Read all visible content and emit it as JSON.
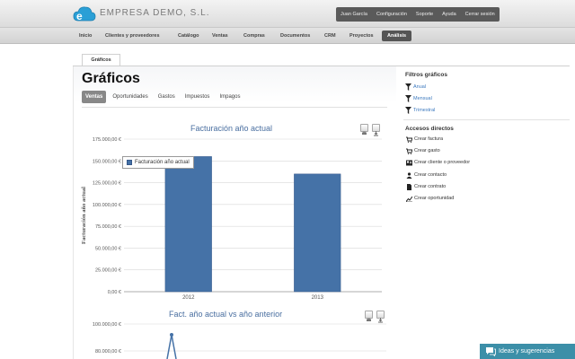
{
  "header": {
    "company": "EMPRESA DEMO, S.L.",
    "user_menu": [
      "Juan García",
      "Configuración",
      "Soporte",
      "Ayuda",
      "Cerrar sesión"
    ]
  },
  "nav": {
    "items": [
      "Inicio",
      "Clientes y proveedores",
      "Catálogo",
      "Ventas",
      "Compras",
      "Documentos",
      "CRM",
      "Proyectos",
      "Análisis"
    ],
    "active": "Análisis"
  },
  "page": {
    "tab": "Gráficos",
    "title": "Gráficos",
    "subtabs": [
      "Ventas",
      "Oportunidades",
      "Gastos",
      "Impuestos",
      "Impagos"
    ],
    "active_subtab": "Ventas"
  },
  "sidebar": {
    "filters_title": "Filtros gráficos",
    "filters": [
      "Anual",
      "Mensual",
      "Trimestral"
    ],
    "quick_title": "Accesos directos",
    "quick": [
      "Crear factura",
      "Crear gasto",
      "Crear cliente o proveedor",
      "Crear contacto",
      "Crear contrato",
      "Crear oportunidad"
    ]
  },
  "chart_data": [
    {
      "type": "bar",
      "title": "Facturación año actual",
      "categories": [
        "2012",
        "2013"
      ],
      "series": [
        {
          "name": "Facturación año actual",
          "values": [
            155000,
            135000
          ]
        }
      ],
      "yticks": [
        "0,00 €",
        "25.000,00 €",
        "50.000,00 €",
        "75.000,00 €",
        "100.000,00 €",
        "125.000,00 €",
        "150.000,00 €",
        "175.000,00 €"
      ],
      "ylim": [
        0,
        175000
      ],
      "ylabel": "Facturación año actual",
      "grid": true,
      "tooltip": "Facturación año actual"
    },
    {
      "type": "line",
      "title": "Fact. año actual vs año anterior",
      "yticks": [
        "80.000,00 €",
        "100.000,00 €"
      ],
      "ylim": [
        0,
        100000
      ],
      "series": [
        {
          "values": [
            92000
          ]
        }
      ],
      "grid": true
    }
  ],
  "feedback": {
    "label": "Ideas y sugerencias"
  },
  "colors": {
    "bar": "#4572a7",
    "accent": "#3c8fa8",
    "link": "#3d7abf"
  }
}
